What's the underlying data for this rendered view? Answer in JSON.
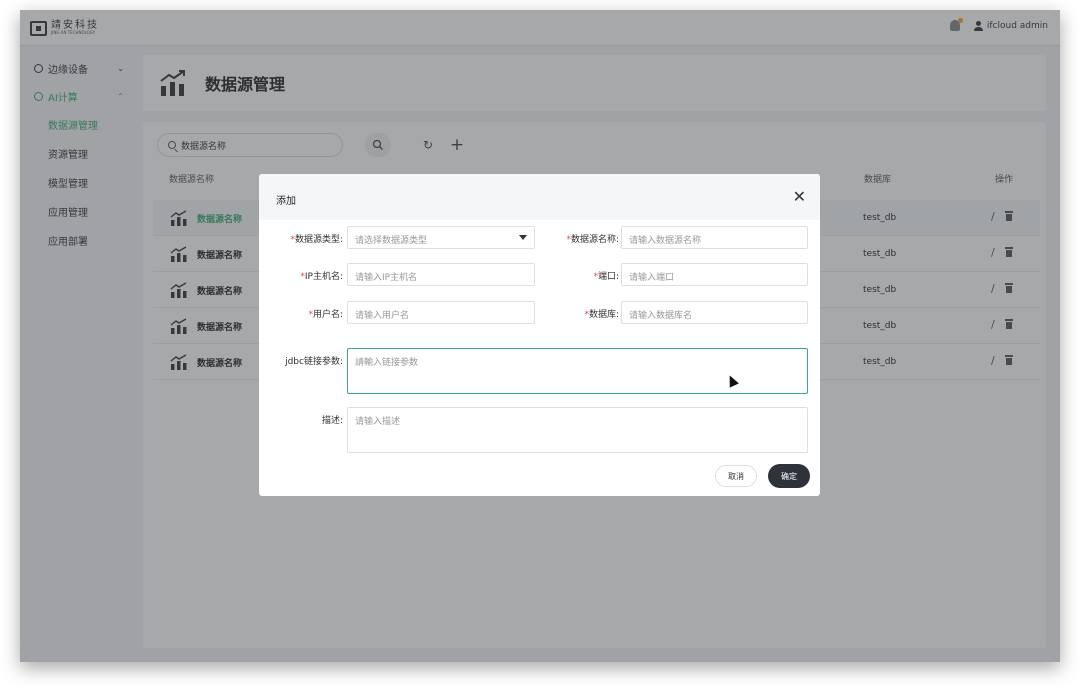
{
  "header": {
    "logo_cn": "靖安科技",
    "logo_en": "JING AN TECHNOLOGY",
    "user": "ifcloud admin"
  },
  "sidebar": {
    "groups": [
      {
        "label": "边缘设备",
        "chevron": "⌄",
        "icon": "circle-dot-icon"
      },
      {
        "label": "AI计算",
        "chevron": "⌃",
        "icon": "circle-dot-icon"
      }
    ],
    "items": [
      {
        "label": "数据源管理"
      },
      {
        "label": "资源管理"
      },
      {
        "label": "模型管理"
      },
      {
        "label": "应用管理"
      },
      {
        "label": "应用部署"
      }
    ]
  },
  "page": {
    "title": "数据源管理"
  },
  "toolbar": {
    "search_value": "数据源名称",
    "refresh": "↻",
    "add": "+"
  },
  "table": {
    "headers": {
      "name": "数据源名称",
      "db": "数据库",
      "action": "操作"
    },
    "rows": [
      {
        "name": "数据源名称",
        "db": "test_db"
      },
      {
        "name": "数据源名称",
        "db": "test_db"
      },
      {
        "name": "数据源名称",
        "db": "test_db"
      },
      {
        "name": "数据源名称",
        "db": "test_db"
      },
      {
        "name": "数据源名称",
        "db": "test_db"
      }
    ],
    "edit_glyph": "/"
  },
  "dialog": {
    "title": "添加",
    "close": "✕",
    "required_mark": "*",
    "fields": {
      "type": {
        "label": "数据源类型:",
        "placeholder": "请选择数据源类型"
      },
      "name": {
        "label": "数据源名称:",
        "placeholder": "请输入数据源名称"
      },
      "host": {
        "label": "IP主机名:",
        "placeholder": "请输入IP主机名"
      },
      "port": {
        "label": "端口:",
        "placeholder": "请输入端口"
      },
      "user": {
        "label": "用户名:",
        "placeholder": "请输入用户名"
      },
      "database": {
        "label": "数据库:",
        "placeholder": "请输入数据库名"
      },
      "jdbc": {
        "label": "jdbc链接参数:",
        "placeholder": "請輸入链接参数"
      },
      "desc": {
        "label": "描述:",
        "placeholder": "请输入描述"
      }
    },
    "cancel": "取消",
    "ok": "确定"
  },
  "colors": {
    "accent": "#3aa874",
    "primary_button": "#2e3239",
    "required": "#e5484d"
  }
}
